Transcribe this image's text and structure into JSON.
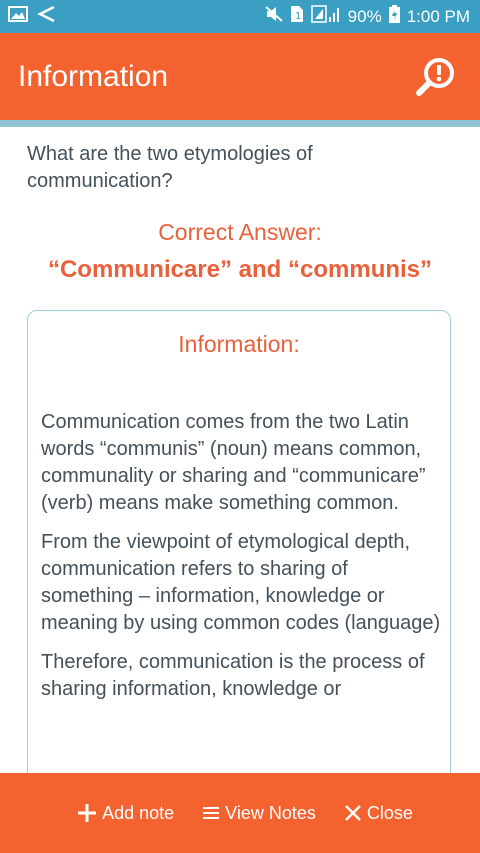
{
  "status_bar": {
    "left_icons": [
      "image-icon",
      "back-arrow-icon"
    ],
    "right_icons": [
      "mute-icon",
      "sim-icon",
      "signal-icon",
      "battery-icon"
    ],
    "battery": "90%",
    "time": "1:00 PM"
  },
  "app_bar": {
    "title": "Information",
    "action_icon": "search-alert-icon"
  },
  "question": "What are the two etymologies of communication?",
  "answer": {
    "label": "Correct Answer:",
    "text": "“Communicare” and “communis”"
  },
  "info": {
    "title": "Information:",
    "paragraphs": [
      "Communication comes from the two Latin words “communis” (noun) means common, communality or sharing and “communicare” (verb) means make something common.",
      "From the viewpoint of etymological depth, communication refers to sharing of something – information, knowledge or meaning by using common codes (language)",
      "Therefore, communication is the process of sharing information, knowledge or"
    ]
  },
  "bottom_bar": {
    "add_note": "Add note",
    "view_notes": "View Notes",
    "close": "Close"
  },
  "colors": {
    "status_bar": "#3a9fc2",
    "app_bar": "#f4622f",
    "accent_text": "#e9603a",
    "body_text": "#44505a",
    "card_border": "#9fd0dc"
  }
}
